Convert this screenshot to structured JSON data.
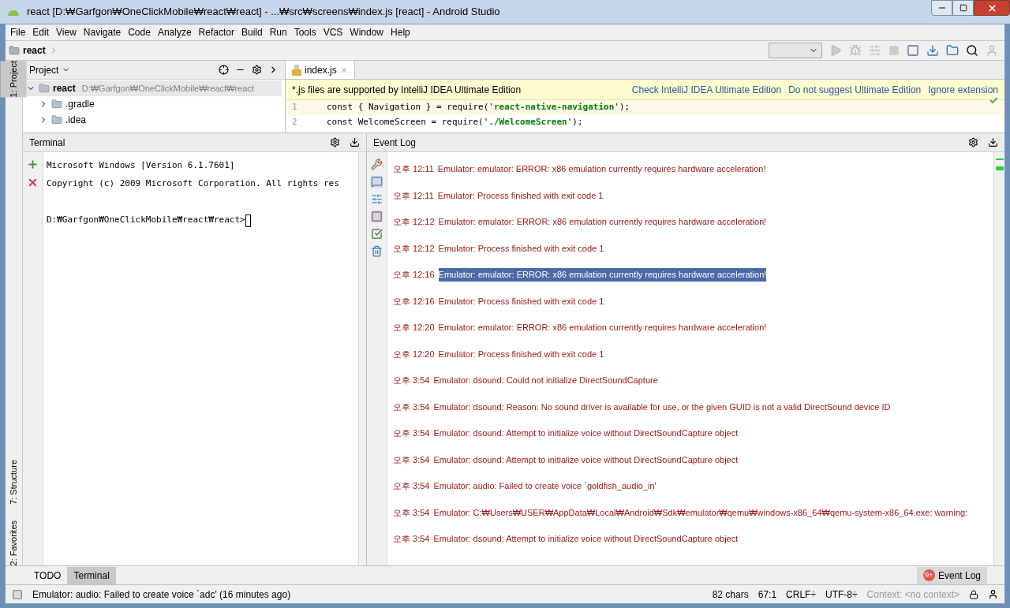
{
  "window": {
    "title": "react [D:₩Garfgon₩OneClickMobile₩react₩react] - ...₩src₩screens₩index.js [react] - Android Studio"
  },
  "menu": [
    "File",
    "Edit",
    "View",
    "Navigate",
    "Code",
    "Analyze",
    "Refactor",
    "Build",
    "Run",
    "Tools",
    "VCS",
    "Window",
    "Help"
  ],
  "breadcrumb": [
    "react"
  ],
  "side_tabs": [
    {
      "label": "1: Project",
      "selected": true
    },
    {
      "label": "7: Structure",
      "selected": false
    },
    {
      "label": "2: Favorites",
      "selected": false
    }
  ],
  "project": {
    "title": "Project",
    "tree": [
      {
        "name": "react",
        "path": "D:₩Garfgon₩OneClickMobile₩react₩react",
        "expanded": true,
        "children": [
          {
            "name": ".gradle",
            "expanded": false
          },
          {
            "name": ".idea",
            "expanded": false
          }
        ]
      }
    ]
  },
  "editor": {
    "tabs": [
      {
        "label": "index.js",
        "selected": true
      }
    ],
    "banner": {
      "text": "*.js files are supported by IntelliJ IDEA Ultimate Edition",
      "links": [
        "Check IntelliJ IDEA Ultimate Edition",
        "Do not suggest Ultimate Edition",
        "Ignore extension"
      ]
    },
    "lines": [
      {
        "number": "1",
        "code": "const { Navigation } = require(",
        "string": "'react-native-navigation'",
        "end": ");",
        "current": true
      },
      {
        "number": "2",
        "code": "const WelcomeScreen = require(",
        "string": "'./WelcomeScreen'",
        "end": ");",
        "current": false
      }
    ]
  },
  "terminal": {
    "title": "Terminal",
    "lines": [
      "Microsoft Windows [Version 6.1.7601]",
      "Copyright (c) 2009 Microsoft Corporation. All rights res"
    ],
    "prompt": "D:₩Garfgon₩OneClickMobile₩react₩react>"
  },
  "event_log": {
    "title": "Event Log",
    "entries": [
      {
        "time": "오후 12:11",
        "message": "Emulator: emulator: ERROR: x86 emulation currently requires hardware acceleration!",
        "selected": false
      },
      {
        "time": "오후 12:11",
        "message": "Emulator: Process finished with exit code 1",
        "selected": false
      },
      {
        "time": "오후 12:12",
        "message": "Emulator: emulator: ERROR: x86 emulation currently requires hardware acceleration!",
        "selected": false
      },
      {
        "time": "오후 12:12",
        "message": "Emulator: Process finished with exit code 1",
        "selected": false
      },
      {
        "time": "오후 12:16",
        "message": "Emulator: emulator: ERROR: x86 emulation currently requires hardware acceleration!",
        "selected": true
      },
      {
        "time": "오후 12:16",
        "message": "Emulator: Process finished with exit code 1",
        "selected": false
      },
      {
        "time": "오후 12:20",
        "message": "Emulator: emulator: ERROR: x86 emulation currently requires hardware acceleration!",
        "selected": false
      },
      {
        "time": "오후 12:20",
        "message": "Emulator: Process finished with exit code 1",
        "selected": false
      },
      {
        "time": "오후 3:54",
        "message": "Emulator: dsound: Could not initialize DirectSoundCapture",
        "selected": false
      },
      {
        "time": "오후 3:54",
        "message": "Emulator: dsound: Reason: No sound driver is available for use, or the given GUID is not a valid DirectSound device ID",
        "selected": false
      },
      {
        "time": "오후 3:54",
        "message": "Emulator: dsound: Attempt to initialize voice without DirectSoundCapture object",
        "selected": false
      },
      {
        "time": "오후 3:54",
        "message": "Emulator: dsound: Attempt to initialize voice without DirectSoundCapture object",
        "selected": false
      },
      {
        "time": "오후 3:54",
        "message": "Emulator: audio: Failed to create voice `goldfish_audio_in'",
        "selected": false
      },
      {
        "time": "오후 3:54",
        "message": "Emulator: C:₩Users₩USER₩AppData₩Local₩Android₩Sdk₩emulator₩qemu₩windows-x86_64₩qemu-system-x86_64.exe: warning:",
        "selected": false
      },
      {
        "time": "오후 3:54",
        "message": "Emulator: dsound: Attempt to initialize voice without DirectSoundCapture object",
        "selected": false
      }
    ]
  },
  "bottom_tabs": [
    {
      "label": "TODO",
      "selected": false
    },
    {
      "label": "Terminal",
      "selected": true
    }
  ],
  "event_log_button": {
    "badge": "9+",
    "label": "Event Log"
  },
  "status_bar": {
    "message": "Emulator: audio: Failed to create voice `adc' (16 minutes ago)",
    "chars": "82 chars",
    "position": "67:1",
    "line_separator": "CRLF÷",
    "encoding": "UTF-8÷",
    "context": "Context: <no context>"
  }
}
